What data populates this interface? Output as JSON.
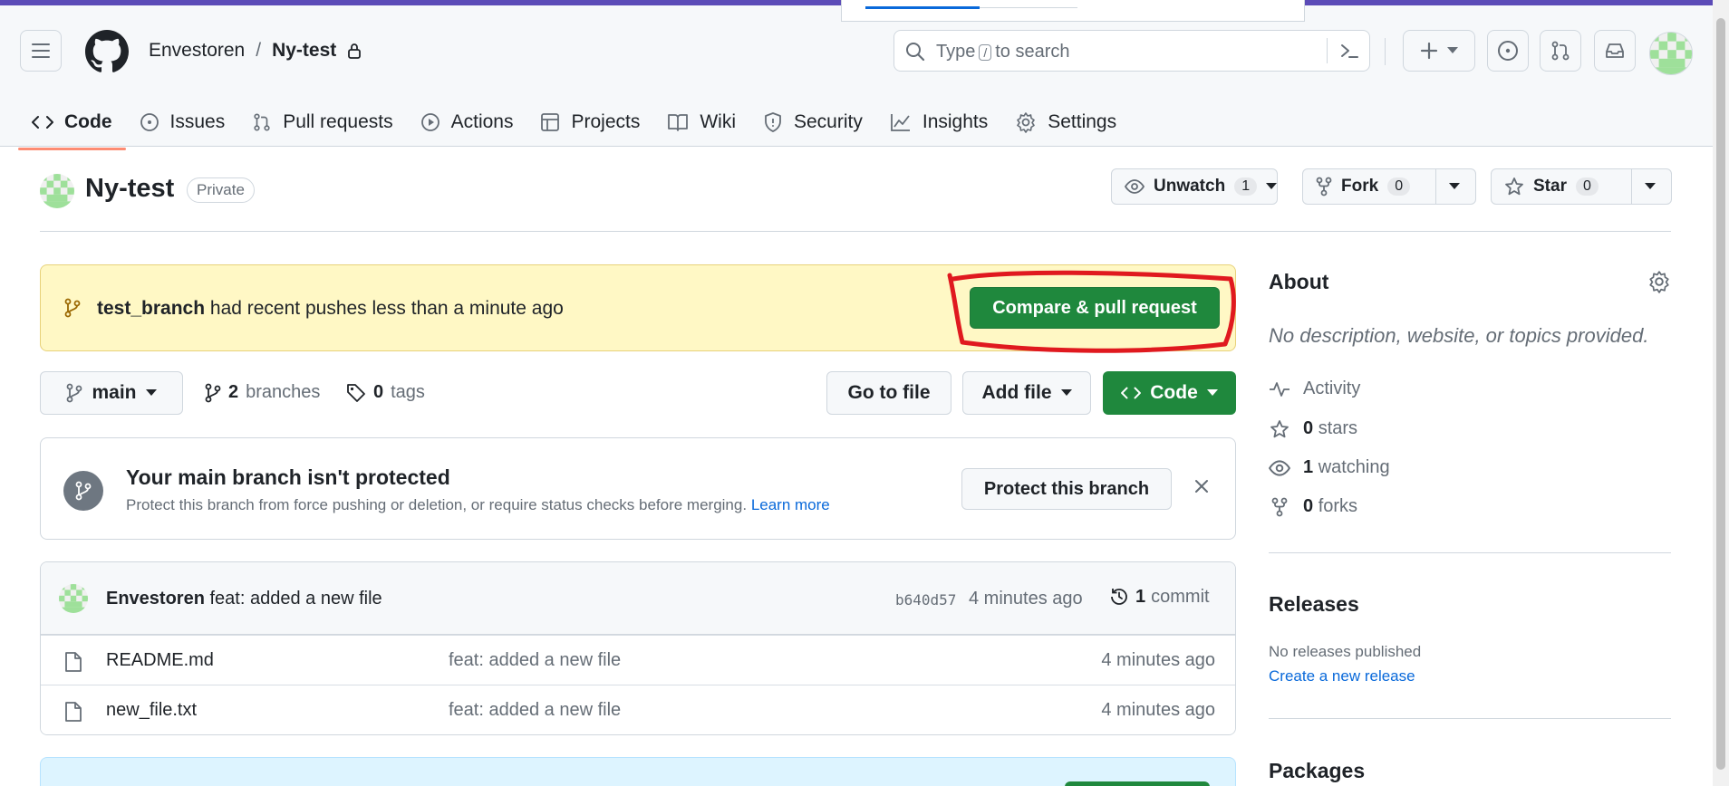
{
  "header": {
    "owner": "Envestoren",
    "separator": "/",
    "repo": "Ny-test",
    "search_pre": "Type",
    "search_key": "/",
    "search_post": "to search"
  },
  "tabs": [
    {
      "label": "Code",
      "icon": "code-icon",
      "selected": true
    },
    {
      "label": "Issues",
      "icon": "issue-icon"
    },
    {
      "label": "Pull requests",
      "icon": "pull-request-icon"
    },
    {
      "label": "Actions",
      "icon": "play-icon"
    },
    {
      "label": "Projects",
      "icon": "table-icon"
    },
    {
      "label": "Wiki",
      "icon": "book-icon"
    },
    {
      "label": "Security",
      "icon": "shield-icon"
    },
    {
      "label": "Insights",
      "icon": "graph-icon"
    },
    {
      "label": "Settings",
      "icon": "gear-icon"
    }
  ],
  "repo_title": {
    "name": "Ny-test",
    "visibility": "Private",
    "unwatch_label": "Unwatch",
    "watch_count": "1",
    "fork_label": "Fork",
    "fork_count": "0",
    "star_label": "Star",
    "star_count": "0"
  },
  "push_banner": {
    "branch": "test_branch",
    "message": "had recent pushes less than a minute ago",
    "button": "Compare & pull request"
  },
  "branch_bar": {
    "branch": "main",
    "branches_count": "2",
    "branches_label": "branches",
    "tags_count": "0",
    "tags_label": "tags",
    "go_to_file": "Go to file",
    "add_file": "Add file",
    "code": "Code"
  },
  "protect": {
    "title": "Your main branch isn't protected",
    "subtitle": "Protect this branch from force pushing or deletion, or require status checks before merging.",
    "learn_more": "Learn more",
    "button": "Protect this branch"
  },
  "commit": {
    "author": "Envestoren",
    "message": "feat: added a new file",
    "sha": "b640d57",
    "ago": "4 minutes ago",
    "commit_count": "1",
    "commit_label": "commit"
  },
  "files": [
    {
      "name": "README.md",
      "message": "feat: added a new file",
      "ago": "4 minutes ago"
    },
    {
      "name": "new_file.txt",
      "message": "feat: added a new file",
      "ago": "4 minutes ago"
    }
  ],
  "sidebar": {
    "about_title": "About",
    "description": "No description, website, or topics provided.",
    "activity": "Activity",
    "stars_count": "0",
    "stars_label": "stars",
    "watching_count": "1",
    "watching_label": "watching",
    "forks_count": "0",
    "forks_label": "forks",
    "releases_title": "Releases",
    "no_releases": "No releases published",
    "create_release": "Create a new release",
    "packages_title": "Packages"
  },
  "colors": {
    "primary_green": "#1f883d",
    "banner_yellow": "#fff8c5",
    "link_blue": "#0969da",
    "annotation_red": "#e0191f",
    "selected_tab_underline": "#fd8c73"
  }
}
